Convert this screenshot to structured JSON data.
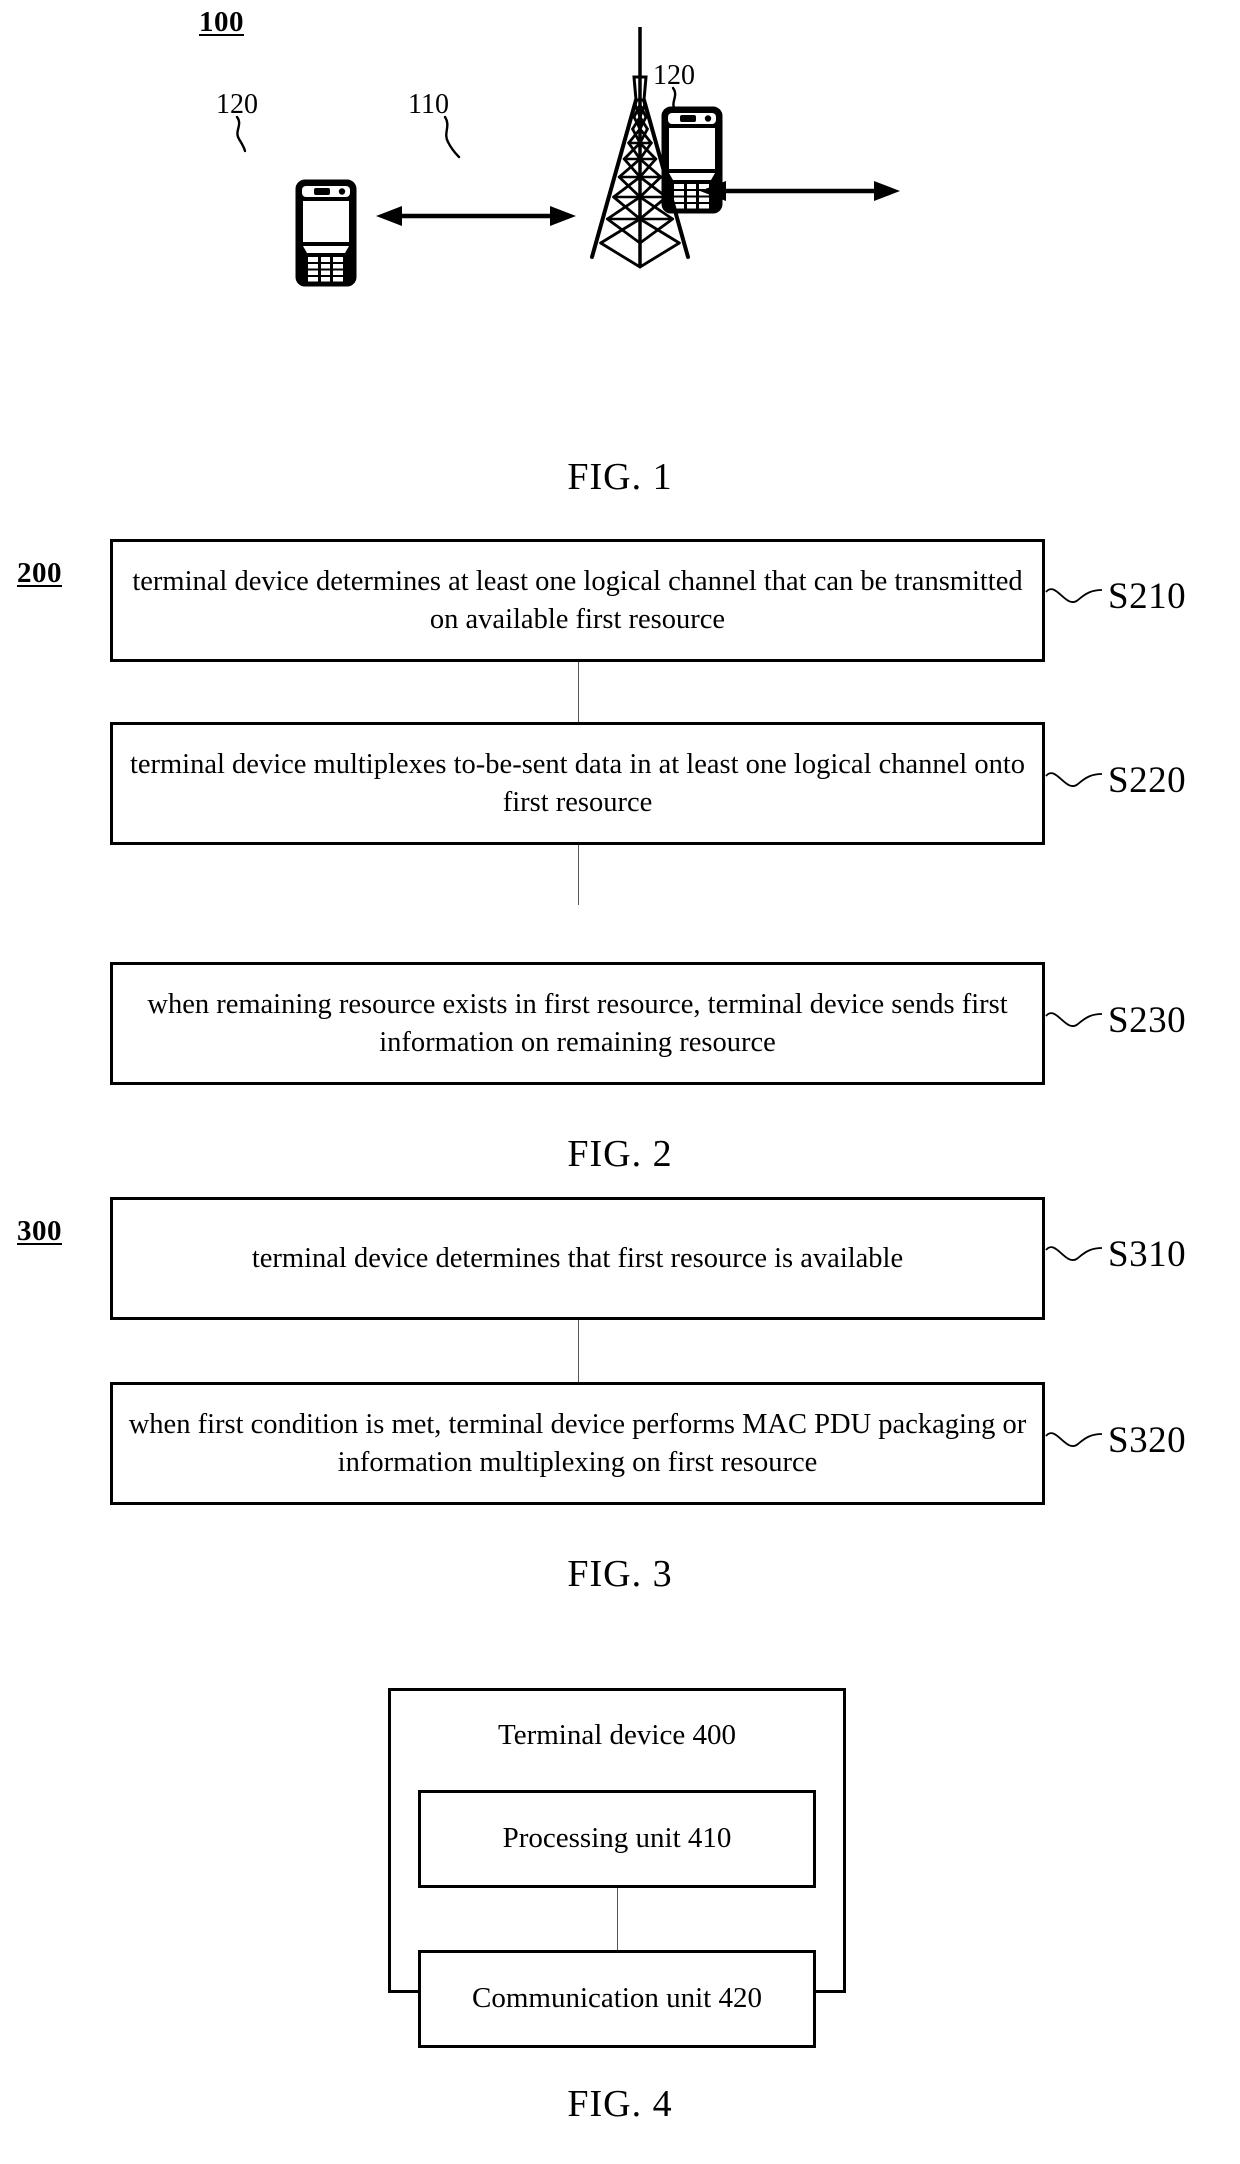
{
  "figure1": {
    "system_ref": "100",
    "base_station_ref": "110",
    "ue_left_ref": "120",
    "ue_right_ref": "120",
    "caption": "FIG. 1",
    "icons": {
      "tower": "cell-tower-icon",
      "phone": "mobile-phone-icon",
      "link": "bidirectional-arrow-icon"
    }
  },
  "figure2": {
    "flow_ref": "200",
    "caption": "FIG. 2",
    "steps": [
      {
        "id": "S210",
        "text": "terminal device determines at least one logical channel that can be transmitted on available first resource"
      },
      {
        "id": "S220",
        "text": "terminal device multiplexes to-be-sent data in at least one logical channel onto first resource"
      },
      {
        "id": "S230",
        "text": "when remaining resource exists in first resource, terminal device sends first information on remaining resource"
      }
    ]
  },
  "figure3": {
    "flow_ref": "300",
    "caption": "FIG. 3",
    "steps": [
      {
        "id": "S310",
        "text": "terminal device determines that first resource is available"
      },
      {
        "id": "S320",
        "text": "when first condition is met, terminal device performs MAC PDU packaging or information multiplexing on first resource"
      }
    ]
  },
  "figure4": {
    "caption": "FIG. 4",
    "outer_title": "Terminal device 400",
    "units": [
      {
        "label": "Processing unit 410"
      },
      {
        "label": "Communication unit 420"
      }
    ]
  },
  "colors": {
    "ink": "#000000",
    "background": "#ffffff",
    "connector": "#555555"
  }
}
